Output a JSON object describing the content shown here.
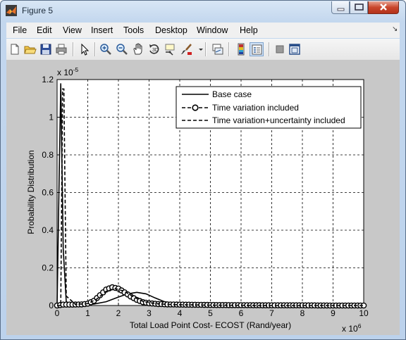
{
  "window": {
    "title": "Figure 5"
  },
  "menu": [
    "File",
    "Edit",
    "View",
    "Insert",
    "Tools",
    "Desktop",
    "Window",
    "Help"
  ],
  "toolbar": [
    "new-figure-icon",
    "open-file-icon",
    "save-icon",
    "print-icon",
    "edit-plot-icon",
    "zoom-in-icon",
    "zoom-out-icon",
    "pan-icon",
    "rotate-3d-icon",
    "data-cursor-icon",
    "brush-icon",
    "link-plot-icon",
    "colorbar-icon",
    "legend-icon",
    "hide-plot-tools-icon",
    "show-plot-tools-icon"
  ],
  "chart_data": {
    "type": "line",
    "xlabel": "Total Load Point Cost- ECOST (Rand/year)",
    "ylabel": "Probability Distribution",
    "x_exponent": "x 10",
    "x_exponent_power": "6",
    "y_exponent": "x 10",
    "y_exponent_power": "-5",
    "xlim": [
      0,
      10
    ],
    "ylim": [
      0,
      1.2
    ],
    "xticks": [
      "0",
      "1",
      "2",
      "3",
      "4",
      "5",
      "6",
      "7",
      "8",
      "9",
      "10"
    ],
    "yticks": [
      "0",
      "0.2",
      "0.4",
      "0.6",
      "0.8",
      "1",
      "1.2"
    ],
    "grid": true,
    "legend_position": "top-right",
    "series": [
      {
        "name": "Base case",
        "style": "solid",
        "x": [
          0,
          0.06,
          0.12,
          0.2,
          0.3,
          0.5,
          0.8,
          1.2,
          1.6,
          2.0,
          2.3,
          2.6,
          2.9,
          3.2,
          3.5,
          4,
          5,
          6,
          7,
          8,
          9,
          10
        ],
        "y": [
          0,
          0.6,
          1.18,
          0.3,
          0.02,
          0.005,
          0.005,
          0.008,
          0.02,
          0.045,
          0.062,
          0.07,
          0.062,
          0.04,
          0.02,
          0.006,
          0.001,
          0.0005,
          0,
          0,
          0,
          0
        ]
      },
      {
        "name": "Time variation included",
        "style": "dash-circle",
        "x": [
          0,
          0.2,
          0.5,
          0.8,
          1.0,
          1.2,
          1.4,
          1.6,
          1.8,
          2.0,
          2.2,
          2.4,
          2.6,
          2.8,
          3.0,
          3.3,
          3.6,
          4,
          4.5,
          5,
          6,
          7,
          8,
          9,
          10
        ],
        "y": [
          0,
          0.005,
          0.005,
          0.006,
          0.01,
          0.025,
          0.055,
          0.085,
          0.097,
          0.09,
          0.07,
          0.048,
          0.03,
          0.018,
          0.012,
          0.008,
          0.006,
          0.005,
          0.004,
          0.003,
          0.002,
          0.001,
          0.001,
          0,
          0
        ]
      },
      {
        "name": "Time variation+uncertainty included",
        "style": "dashed",
        "x": [
          0,
          0.08,
          0.12,
          0.18,
          0.22,
          0.3,
          0.6,
          1.0,
          1.3,
          1.6,
          1.9,
          2.2,
          2.5,
          2.8,
          3.2,
          3.6,
          4,
          5,
          6,
          7,
          8,
          9,
          10
        ],
        "y": [
          0,
          0.0,
          0.0,
          1.15,
          1.15,
          0.05,
          0.006,
          0.01,
          0.035,
          0.075,
          0.09,
          0.075,
          0.045,
          0.022,
          0.01,
          0.006,
          0.004,
          0.002,
          0.001,
          0,
          0,
          0,
          0
        ]
      }
    ]
  }
}
